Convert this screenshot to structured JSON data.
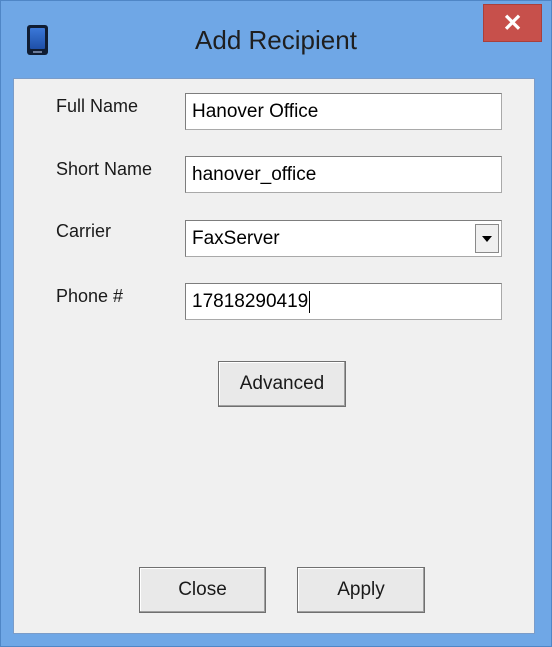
{
  "window": {
    "title": "Add Recipient",
    "close_glyph": "✕"
  },
  "icons": {
    "app": "phone-icon",
    "close": "close-icon",
    "dropdown": "chevron-down-icon"
  },
  "form": {
    "full_name": {
      "label": "Full Name",
      "value": "Hanover Office"
    },
    "short_name": {
      "label": "Short Name",
      "value": "hanover_office"
    },
    "carrier": {
      "label": "Carrier",
      "value": "FaxServer"
    },
    "phone": {
      "label": "Phone #",
      "value": "17818290419"
    }
  },
  "buttons": {
    "advanced": "Advanced",
    "close": "Close",
    "apply": "Apply"
  },
  "colors": {
    "title_bar": "#6fa7e6",
    "close_button": "#c7504b",
    "client_background": "#f0f0f0"
  }
}
